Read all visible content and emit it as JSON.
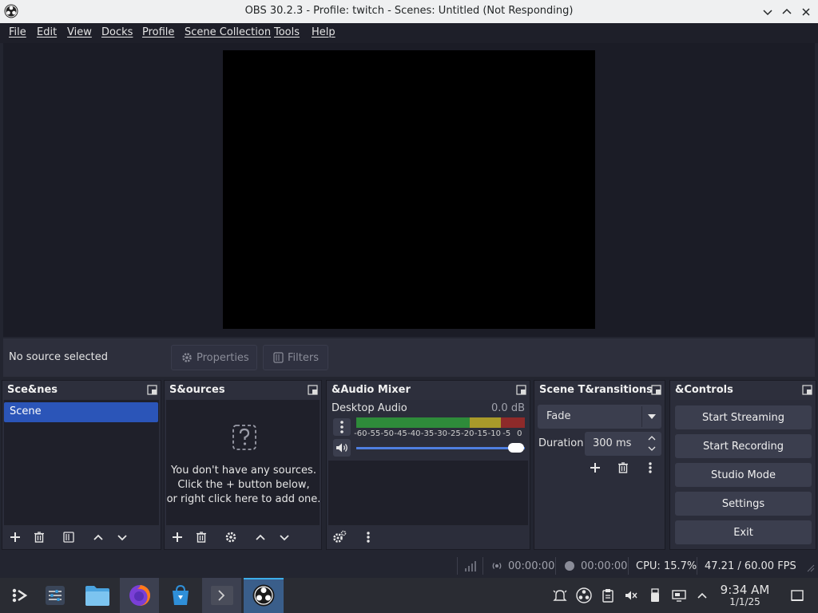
{
  "window": {
    "title": "OBS 30.2.3 - Profile: twitch - Scenes: Untitled (Not Responding)"
  },
  "menu": [
    "File",
    "Edit",
    "View",
    "Docks",
    "Profile",
    "Scene Collection",
    "Tools",
    "Help"
  ],
  "context": {
    "no_source": "No source selected",
    "properties_label": "Properties",
    "filters_label": "Filters"
  },
  "docks": {
    "scenes": {
      "title": "Sce&nes",
      "items": [
        "Scene"
      ]
    },
    "sources": {
      "title": "S&ources",
      "empty_line1": "You don't have any sources.",
      "empty_line2": "Click the + button below,",
      "empty_line3": "or right click here to add one."
    },
    "mixer": {
      "title": "&Audio Mixer",
      "channel_name": "Desktop Audio",
      "channel_db": "0.0 dB",
      "scale": [
        "-60",
        "-55",
        "-50",
        "-45",
        "-40",
        "-35",
        "-30",
        "-25",
        "-20",
        "-15",
        "-10",
        "-5",
        "0"
      ],
      "volume_fraction": 1.0
    },
    "transitions": {
      "title": "Scene T&ransitions",
      "selected": "Fade",
      "duration_label": "Duration",
      "duration_value": "300 ms"
    },
    "controls": {
      "title": "&Controls",
      "buttons": [
        "Start Streaming",
        "Start Recording",
        "Studio Mode",
        "Settings",
        "Exit"
      ]
    }
  },
  "status": {
    "stream_time": "00:00:00",
    "record_time": "00:00:00",
    "cpu": "CPU: 15.7%",
    "fps": "47.21 / 60.00 FPS"
  },
  "taskbar": {
    "time": "9:34 AM",
    "date": "1/1/25"
  },
  "colors": {
    "accent": "#2b55b8",
    "background": "#1f202a",
    "meter_green": "#2e8b3a",
    "meter_yellow": "#a89a2a",
    "meter_red": "#8e2a2a"
  }
}
